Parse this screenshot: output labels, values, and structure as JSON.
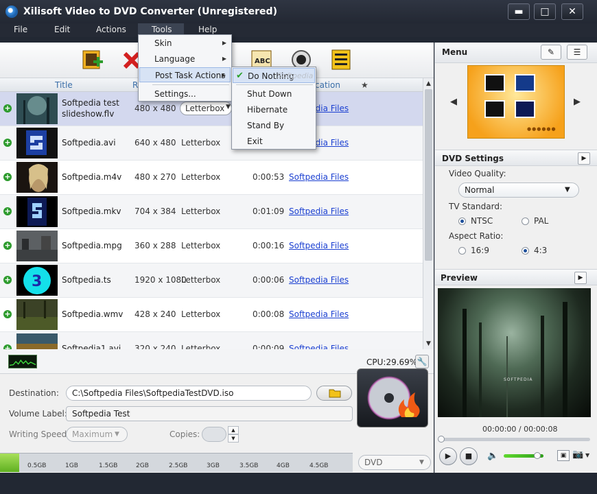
{
  "window": {
    "title": "Xilisoft Video to DVD Converter (Unregistered)"
  },
  "menubar": [
    "File",
    "Edit",
    "Actions",
    "Tools",
    "Help"
  ],
  "tools_menu": {
    "items": [
      "Skin",
      "Language",
      "Post Task Actions",
      "Settings..."
    ],
    "post_task": [
      "Do Nothing",
      "Shut Down",
      "Hibernate",
      "Stand By",
      "Exit"
    ],
    "post_task_watermark": "Softpedia"
  },
  "columns": {
    "title": "Title",
    "r": "R",
    "location": "cation",
    "star": "★"
  },
  "files": [
    {
      "title": "Softpedia test",
      "title2": "slideshow.flv",
      "size": "480 x 480",
      "aspect": "Letterbox",
      "duration": "",
      "location": "Softpedia Files"
    },
    {
      "title": "Softpedia.avi",
      "title2": "",
      "size": "640 x 480",
      "aspect": "Letterbox",
      "duration": "",
      "location": "Softpedia Files"
    },
    {
      "title": "Softpedia.m4v",
      "title2": "",
      "size": "480 x 270",
      "aspect": "Letterbox",
      "duration": "0:00:53",
      "location": "Softpedia Files"
    },
    {
      "title": "Softpedia.mkv",
      "title2": "",
      "size": "704 x 384",
      "aspect": "Letterbox",
      "duration": "0:01:09",
      "location": "Softpedia Files"
    },
    {
      "title": "Softpedia.mpg",
      "title2": "",
      "size": "360 x 288",
      "aspect": "Letterbox",
      "duration": "0:00:16",
      "location": "Softpedia Files"
    },
    {
      "title": "Softpedia.ts",
      "title2": "",
      "size": "1920 x 1080",
      "aspect": "Letterbox",
      "duration": "0:00:06",
      "location": "Softpedia Files"
    },
    {
      "title": "Softpedia.wmv",
      "title2": "",
      "size": "428 x 240",
      "aspect": "Letterbox",
      "duration": "0:00:08",
      "location": "Softpedia Files"
    },
    {
      "title": "Softpedia1.avi",
      "title2": "",
      "size": "320 x 240",
      "aspect": "Letterbox",
      "duration": "0:00:09",
      "location": "Softpedia Files"
    }
  ],
  "cpu": "CPU:29.69%",
  "destination": {
    "label": "Destination:",
    "value": "C:\\Softpedia Files\\SoftpediaTestDVD.iso",
    "volume_label": "Volume Label:",
    "volume_value": "Softpedia Test",
    "speed_label": "Writing Speed:",
    "speed_value": "Maximum",
    "copies_label": "Copies:"
  },
  "size_ticks": [
    "0.5GB",
    "1GB",
    "1.5GB",
    "2GB",
    "2.5GB",
    "3GB",
    "3.5GB",
    "4GB",
    "4.5GB"
  ],
  "format": "DVD",
  "menu_panel": {
    "title": "Menu"
  },
  "dvd_settings": {
    "title": "DVD Settings",
    "quality_label": "Video Quality:",
    "quality": "Normal",
    "tv_label": "TV Standard:",
    "ntsc": "NTSC",
    "pal": "PAL",
    "aspect_label": "Aspect Ratio:",
    "a169": "16:9",
    "a43": "4:3"
  },
  "preview": {
    "title": "Preview",
    "time": "00:00:00 / 00:00:08",
    "overlay": "SOFTPEDIA"
  }
}
